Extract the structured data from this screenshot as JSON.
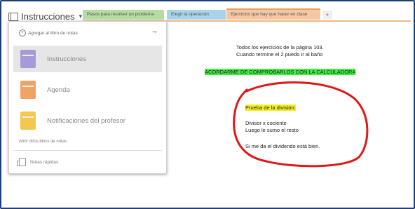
{
  "notebook_title": "Instrucciones",
  "tabs": [
    "Pasos para resolver un problema",
    "Elegir la operación",
    "Ejercicios que hay que hacer en clase",
    "+"
  ],
  "panel": {
    "add_label": "Agregar al libro de notas",
    "notebooks": [
      {
        "label": "Instrucciones",
        "color": "#a79ad8",
        "selected": true
      },
      {
        "label": "Agenda",
        "color": "#f0a464"
      },
      {
        "label": "Notificaciones del profesor",
        "color": "#f4c74e"
      }
    ],
    "open_other": "Abrir otros blocs de notas",
    "quick_notes": "Notas rápidas"
  },
  "page": {
    "line1": "Todos los ejercicios de la página 103.",
    "line2": "Cuando termine el 2 puedo ir al baño",
    "banner": "ACORDARME DE COMPROBARLOS CON LA CALCULADORA",
    "prueba": "Prueba de la división:",
    "line3": "Divisor x cociente",
    "line4": "Luego le sumo el resto",
    "line5": "Si me da el dividendo está bien."
  },
  "colors": {
    "annotation": "#e01818",
    "highlight_green": "#3df03d",
    "highlight_yellow": "#f5f020"
  }
}
